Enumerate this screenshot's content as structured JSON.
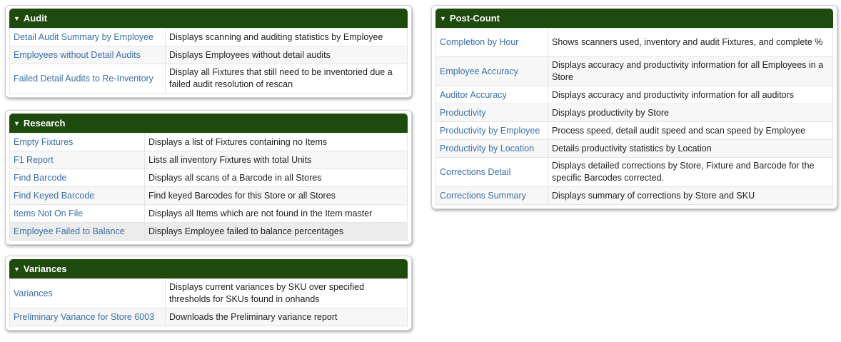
{
  "audit": {
    "title": "Audit",
    "rows": [
      {
        "link": "Detail Audit Summary by Employee",
        "desc": "Displays scanning and auditing statistics by Employee"
      },
      {
        "link": "Employees without Detail Audits",
        "desc": "Displays Employees without detail audits"
      },
      {
        "link": "Failed Detail Audits to Re-Inventory",
        "desc": "Display all Fixtures that still need to be inventoried due a failed audit resolution of rescan"
      }
    ]
  },
  "research": {
    "title": "Research",
    "rows": [
      {
        "link": "Empty Fixtures",
        "desc": "Displays a list of Fixtures containing no Items"
      },
      {
        "link": "F1 Report",
        "desc": "Lists all inventory Fixtures with total Units"
      },
      {
        "link": "Find Barcode",
        "desc": "Displays all scans of a Barcode in all Stores"
      },
      {
        "link": "Find Keyed Barcode",
        "desc": "Find keyed Barcodes for this Store or all Stores"
      },
      {
        "link": "Items Not On File",
        "desc": "Displays all Items which are not found in the Item master"
      },
      {
        "link": "Employee Failed to Balance",
        "desc": "Displays Employee failed to balance percentages"
      }
    ]
  },
  "variances": {
    "title": "Variances",
    "rows": [
      {
        "link": "Variances",
        "desc": "Displays current variances by SKU over specified thresholds for SKUs found in onhands"
      },
      {
        "link": "Preliminary Variance for Store 6003",
        "desc": "Downloads the Preliminary variance report"
      }
    ]
  },
  "postcount": {
    "title": "Post-Count",
    "rows": [
      {
        "link": "Completion by Hour",
        "desc": "Shows scanners used, inventory and audit Fixtures, and complete %"
      },
      {
        "link": "Employee Accuracy",
        "desc": "Displays accuracy and productivity information for all Employees in a Store"
      },
      {
        "link": "Auditor Accuracy",
        "desc": "Displays accuracy and productivity information for all auditors"
      },
      {
        "link": "Productivity",
        "desc": "Displays productivity by Store"
      },
      {
        "link": "Productivity by Employee",
        "desc": "Process speed, detail audit speed and scan speed by Employee"
      },
      {
        "link": "Productivity by Location",
        "desc": "Details productivity statistics by Location"
      },
      {
        "link": "Corrections Detail",
        "desc": "Displays detailed corrections by Store, Fixture and Barcode for the specific Barcodes corrected."
      },
      {
        "link": "Corrections Summary",
        "desc": "Displays summary of corrections by Store and SKU"
      }
    ]
  },
  "icons": {
    "collapse": "caret-down-icon"
  },
  "colors": {
    "header_bg": "#1e4a0e",
    "link": "#3a6fa8"
  }
}
